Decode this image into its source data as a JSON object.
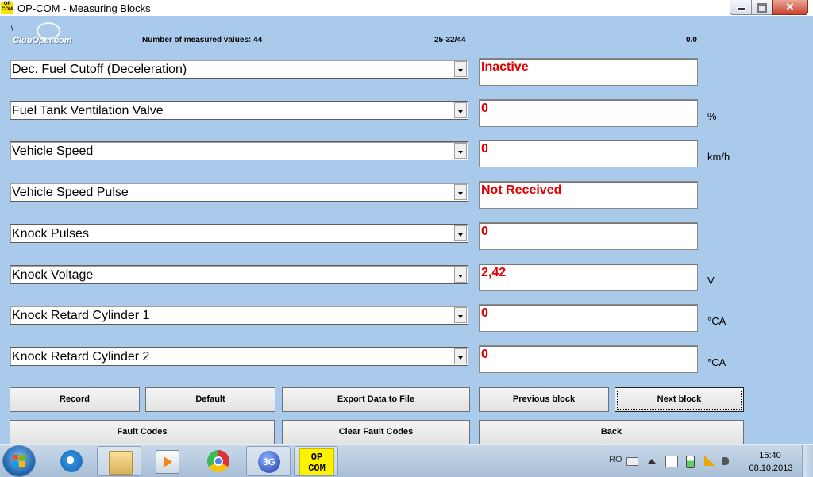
{
  "window": {
    "title": "OP-COM - Measuring Blocks",
    "app_icon_text": "OP COM",
    "close_label": "✕"
  },
  "logo": {
    "slash": "\\",
    "text": "ClubOpel.com"
  },
  "info": {
    "measured_count_label": "Number of measured values: 44",
    "range": "25-32/44",
    "value": "0.0"
  },
  "measurements": [
    {
      "name": "Dec. Fuel Cutoff (Deceleration)",
      "value": "Inactive",
      "unit": ""
    },
    {
      "name": "Fuel Tank Ventilation Valve",
      "value": "0",
      "unit": "%"
    },
    {
      "name": "Vehicle Speed",
      "value": "0",
      "unit": "km/h"
    },
    {
      "name": "Vehicle Speed Pulse",
      "value": "Not Received",
      "unit": ""
    },
    {
      "name": "Knock Pulses",
      "value": "0",
      "unit": ""
    },
    {
      "name": "Knock Voltage",
      "value": "2,42",
      "unit": "V"
    },
    {
      "name": "Knock Retard Cylinder 1",
      "value": "0",
      "unit": "°CA"
    },
    {
      "name": "Knock Retard Cylinder 2",
      "value": "0",
      "unit": "°CA"
    }
  ],
  "buttons": {
    "record": "Record",
    "default": "Default",
    "export": "Export Data to File",
    "previous_block": "Previous block",
    "next_block": "Next block",
    "fault_codes": "Fault Codes",
    "clear_fault_codes": "Clear Fault Codes",
    "back": "Back"
  },
  "taskbar": {
    "items": [
      "start-button",
      "internet-explorer",
      "windows-explorer",
      "media-player",
      "chrome",
      "3g-connection",
      "op-com"
    ],
    "g3_label": "3G",
    "opcom_label": "OP COM",
    "language": "RO",
    "time": "15:40",
    "date": "08.10.2013"
  },
  "colors": {
    "background": "#a9caea",
    "value_text": "#e00000"
  }
}
